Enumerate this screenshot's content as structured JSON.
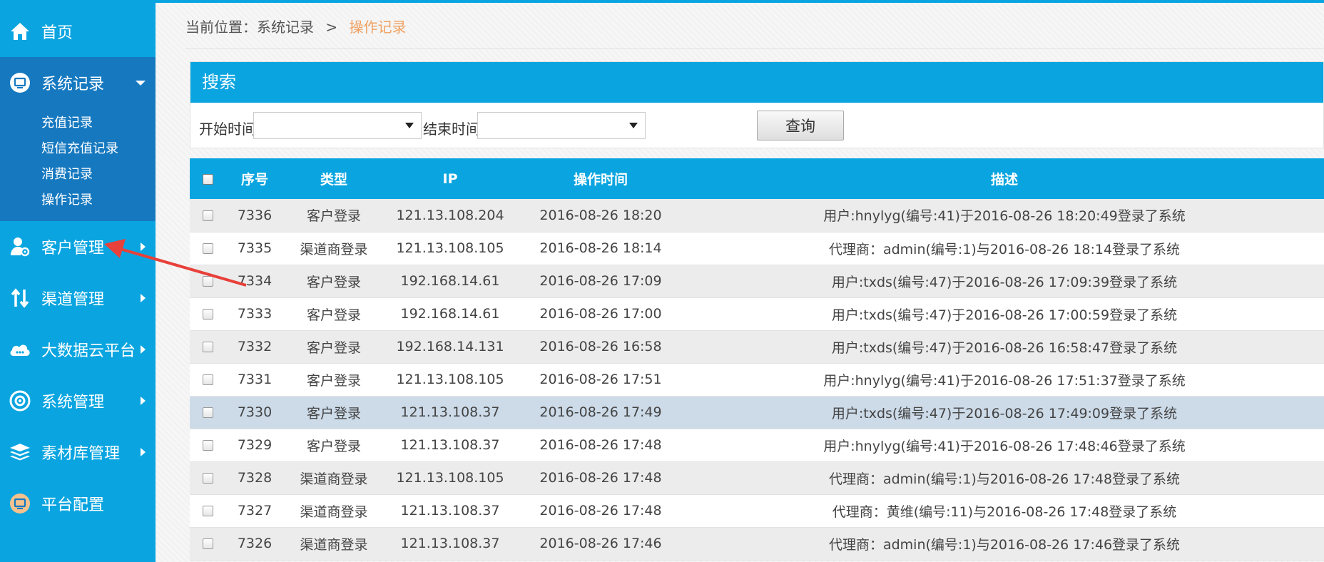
{
  "sidebar": {
    "home": {
      "label": "首页",
      "icon": "home-icon"
    },
    "system_records": {
      "label": "系统记录",
      "icon": "monitor-icon",
      "sub_items": [
        {
          "label": "充值记录"
        },
        {
          "label": "短信充值记录"
        },
        {
          "label": "消费记录"
        },
        {
          "label": "操作记录"
        }
      ]
    },
    "items": [
      {
        "label": "客户管理",
        "icon": "user-gear-icon"
      },
      {
        "label": "渠道管理",
        "icon": "swap-arrows-icon"
      },
      {
        "label": "大数据云平台",
        "icon": "cloud-icon"
      },
      {
        "label": "系统管理",
        "icon": "settings-icon"
      },
      {
        "label": "素材库管理",
        "icon": "layers-icon"
      },
      {
        "label": "平台配置",
        "icon": "config-monitor-icon"
      }
    ]
  },
  "breadcrumb": {
    "prefix": "当前位置：系统记录",
    "separator": ">",
    "current": "操作记录"
  },
  "search": {
    "title": "搜索",
    "start_label": "开始时间",
    "end_label": "结束时间",
    "start_value": "",
    "end_value": "",
    "query_label": "查询"
  },
  "table": {
    "headers": {
      "id": "序号",
      "type": "类型",
      "ip": "IP",
      "time": "操作时间",
      "desc": "描述"
    },
    "rows": [
      {
        "id": "7336",
        "type": "客户登录",
        "ip": "121.13.108.204",
        "time": "2016-08-26 18:20",
        "desc": "用户:hnylyg(编号:41)于2016-08-26 18:20:49登录了系统"
      },
      {
        "id": "7335",
        "type": "渠道商登录",
        "ip": "121.13.108.105",
        "time": "2016-08-26 18:14",
        "desc": "代理商：admin(编号:1)与2016-08-26 18:14登录了系统"
      },
      {
        "id": "7334",
        "type": "客户登录",
        "ip": "192.168.14.61",
        "time": "2016-08-26 17:09",
        "desc": "用户:txds(编号:47)于2016-08-26 17:09:39登录了系统"
      },
      {
        "id": "7333",
        "type": "客户登录",
        "ip": "192.168.14.61",
        "time": "2016-08-26 17:00",
        "desc": "用户:txds(编号:47)于2016-08-26 17:00:59登录了系统"
      },
      {
        "id": "7332",
        "type": "客户登录",
        "ip": "192.168.14.131",
        "time": "2016-08-26 16:58",
        "desc": "用户:txds(编号:47)于2016-08-26 16:58:47登录了系统"
      },
      {
        "id": "7331",
        "type": "客户登录",
        "ip": "121.13.108.105",
        "time": "2016-08-26 17:51",
        "desc": "用户:hnylyg(编号:41)于2016-08-26 17:51:37登录了系统"
      },
      {
        "id": "7330",
        "type": "客户登录",
        "ip": "121.13.108.37",
        "time": "2016-08-26 17:49",
        "desc": "用户:txds(编号:47)于2016-08-26 17:49:09登录了系统"
      },
      {
        "id": "7329",
        "type": "客户登录",
        "ip": "121.13.108.37",
        "time": "2016-08-26 17:48",
        "desc": "用户:hnylyg(编号:41)于2016-08-26 17:48:46登录了系统"
      },
      {
        "id": "7328",
        "type": "渠道商登录",
        "ip": "121.13.108.105",
        "time": "2016-08-26 17:48",
        "desc": "代理商：admin(编号:1)与2016-08-26 17:48登录了系统"
      },
      {
        "id": "7327",
        "type": "渠道商登录",
        "ip": "121.13.108.37",
        "time": "2016-08-26 17:48",
        "desc": "代理商：黄维(编号:11)与2016-08-26 17:48登录了系统"
      },
      {
        "id": "7326",
        "type": "渠道商登录",
        "ip": "121.13.108.37",
        "time": "2016-08-26 17:46",
        "desc": "代理商：admin(编号:1)与2016-08-26 17:46登录了系统"
      }
    ]
  },
  "colors": {
    "primary": "#0aa5e0",
    "sidebar_open": "#1679c0",
    "breadcrumb_current": "#f0a060",
    "row_highlight": "#cddbe9",
    "annotation_arrow": "#e8403a"
  }
}
